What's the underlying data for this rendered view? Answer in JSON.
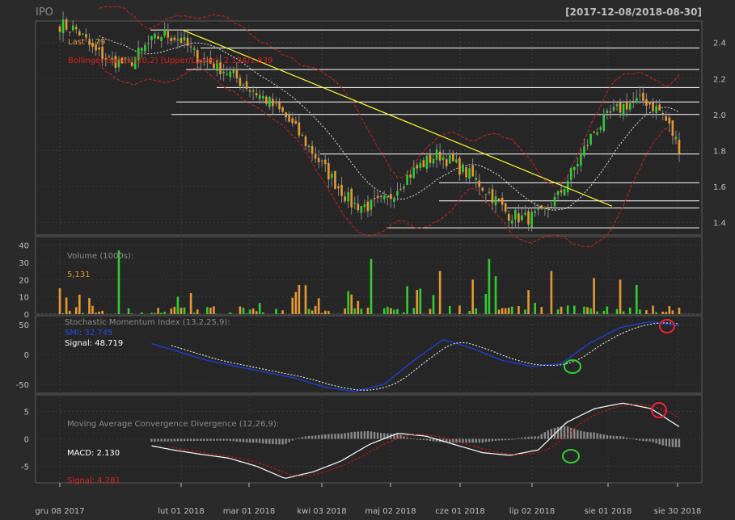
{
  "header": {
    "symbol": "IPO",
    "date_range": "[2017-12-08/2018-08-30]"
  },
  "colors": {
    "background": "#2a2a2a",
    "panel": "#262626",
    "grid": "#3a3a3a",
    "frame": "#5a5a5a",
    "axis_text": "#bdbdbd",
    "up": "#33cc33",
    "down": "#e69933",
    "bb": "#cc2222",
    "trend": "#ffff33",
    "level": "#ffffff",
    "smi": "#1f3fd0",
    "signal": "#ffffff",
    "macd_signal": "#d01515",
    "hist": "#8a8a8a",
    "circle_green": "#33cc33",
    "circle_red": "#ee2233"
  },
  "labels": {
    "last": "Last 1.79",
    "bbands": "Bollinger Bands (20,2) [Upper/Lower]: 2.134/1.839",
    "volume_title": "Volume (1000s):",
    "volume_value": "5,131",
    "smi_title": "Stochastic Momentum Index (13,2,25,9):",
    "smi_value": "SMI: 32.745",
    "smi_signal": "Signal: 48.719",
    "macd_title": "Moving Average Convergence Divergence (12,26,9):",
    "macd_value": "MACD: 2.130",
    "macd_signal": "Signal: 4.281"
  },
  "chart_data": [
    {
      "type": "candlestick",
      "panel": "price",
      "ylim": [
        1.33,
        2.52
      ],
      "yticks": [
        1.4,
        1.6,
        1.8,
        2.0,
        2.2,
        2.4
      ],
      "x_ticks": [
        "gru 08 2017",
        "lut 01 2018",
        "mar 01 2018",
        "kwi 03 2018",
        "maj 02 2018",
        "cze 01 2018",
        "lip 02 2018",
        "sie 01 2018",
        "sie 30 2018"
      ],
      "close_path": [
        2.5,
        2.47,
        2.35,
        2.3,
        2.28,
        2.38,
        2.45,
        2.42,
        2.32,
        2.28,
        2.22,
        2.15,
        2.08,
        2.0,
        1.88,
        1.75,
        1.62,
        1.5,
        1.49,
        1.52,
        1.64,
        1.72,
        1.78,
        1.72,
        1.65,
        1.56,
        1.45,
        1.42,
        1.44,
        1.55,
        1.72,
        1.9,
        2.0,
        2.06,
        2.08,
        2.01,
        1.82
      ],
      "last": 1.79,
      "bbands": {
        "upper": 2.134,
        "lower": 1.839
      },
      "horizontal_levels": [
        2.47,
        2.37,
        2.25,
        2.15,
        2.07,
        2.0,
        1.78,
        1.62,
        1.52,
        1.48,
        1.37
      ],
      "trendline": {
        "from": [
          "2018-01-01",
          2.47
        ],
        "to": [
          "2018-07-26",
          1.49
        ]
      },
      "annotations": [
        "Last 1.79",
        "Bollinger Bands (20,2) [Upper/Lower]: 2.134/1.839"
      ]
    },
    {
      "type": "bar",
      "panel": "volume",
      "ylim": [
        0,
        45
      ],
      "yticks": [
        0,
        10,
        20,
        30,
        40
      ],
      "ylabel": "Volume (1000s):",
      "last": 5131
    },
    {
      "type": "line",
      "panel": "smi",
      "title": "Stochastic Momentum Index (13,2,25,9):",
      "ylim": [
        -65,
        65
      ],
      "yticks": [
        -50,
        0,
        50
      ],
      "series": [
        {
          "name": "SMI",
          "last": 32.745,
          "path": [
            -5,
            10,
            25,
            20,
            5,
            -10,
            -20,
            -30,
            -40,
            -55,
            -62,
            -50,
            -10,
            25,
            10,
            -10,
            -20,
            -15,
            20,
            45,
            55,
            48
          ]
        },
        {
          "name": "Signal",
          "last": 48.719
        }
      ]
    },
    {
      "type": "line",
      "panel": "macd",
      "title": "Moving Average Convergence Divergence (12,26,9):",
      "ylim": [
        -8,
        8
      ],
      "yticks": [
        -5,
        0,
        5
      ],
      "series": [
        {
          "name": "MACD",
          "last": 2.13,
          "path": [
            -0.5,
            0.5,
            0.2,
            -1.0,
            -2.0,
            -2.8,
            -3.5,
            -5.0,
            -7.2,
            -6.0,
            -4.0,
            -1.0,
            1.0,
            0.5,
            -1.0,
            -2.5,
            -3.0,
            -2.0,
            3.0,
            5.5,
            6.5,
            5.5,
            2.2
          ]
        },
        {
          "name": "Signal",
          "last": 4.281
        }
      ]
    }
  ]
}
